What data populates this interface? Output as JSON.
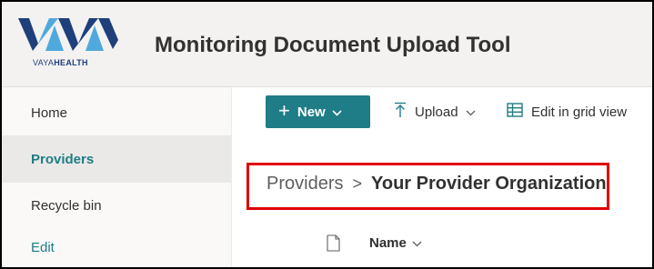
{
  "header": {
    "logo_brand_prefix": "VAYA",
    "logo_brand_suffix": "HEALTH",
    "site_title": "Monitoring Document Upload Tool"
  },
  "nav": {
    "items": [
      {
        "label": "Home",
        "selected": false
      },
      {
        "label": "Providers",
        "selected": true
      },
      {
        "label": "Recycle bin",
        "selected": false
      },
      {
        "label": "Edit",
        "selected": false
      }
    ]
  },
  "commandbar": {
    "new_label": "New",
    "upload_label": "Upload",
    "grid_label": "Edit in grid view"
  },
  "breadcrumb": {
    "parent": "Providers",
    "separator": ">",
    "current": "Your Provider Organization"
  },
  "list": {
    "name_column": "Name"
  },
  "colors": {
    "accent": "#1e7d86",
    "highlight_border": "#e00000",
    "logo_dark": "#1e3f7a",
    "logo_light": "#4fa9dc"
  },
  "icons": {
    "new_plus": "plus-icon",
    "upload": "upload-icon",
    "grid": "grid-view-icon",
    "file": "file-icon",
    "chevron": "chevron-down-icon"
  }
}
